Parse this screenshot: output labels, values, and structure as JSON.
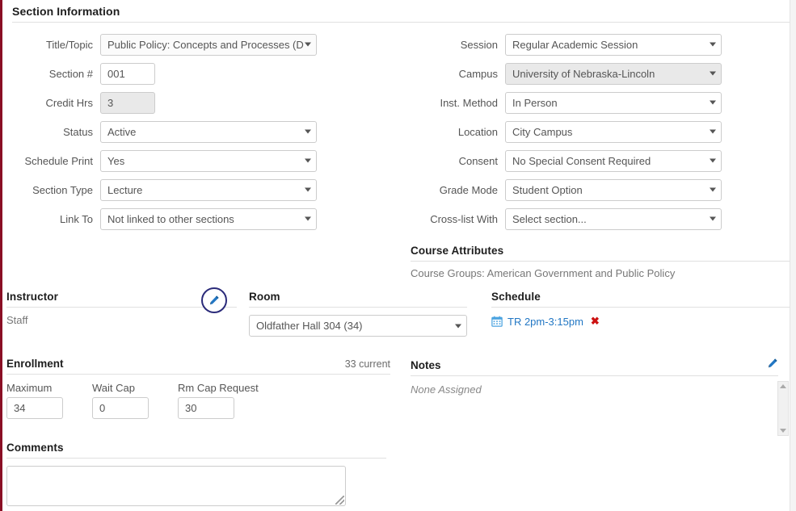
{
  "section_information": {
    "heading": "Section Information",
    "left_fields": [
      {
        "label": "Title/Topic",
        "value": "Public Policy: Concepts and Processes (D",
        "type": "select",
        "state": "readonly-light"
      },
      {
        "label": "Section #",
        "value": "001",
        "type": "input",
        "state": "normal"
      },
      {
        "label": "Credit Hrs",
        "value": "3",
        "type": "input",
        "state": "disabled"
      },
      {
        "label": "Status",
        "value": "Active",
        "type": "select",
        "state": "normal"
      },
      {
        "label": "Schedule Print",
        "value": "Yes",
        "type": "select",
        "state": "normal"
      },
      {
        "label": "Section Type",
        "value": "Lecture",
        "type": "select",
        "state": "normal"
      },
      {
        "label": "Link To",
        "value": "Not linked to other sections",
        "type": "select",
        "state": "normal"
      }
    ],
    "right_fields": [
      {
        "label": "Session",
        "value": "Regular Academic Session",
        "type": "select",
        "state": "normal"
      },
      {
        "label": "Campus",
        "value": "University of Nebraska-Lincoln",
        "type": "select",
        "state": "disabled"
      },
      {
        "label": "Inst. Method",
        "value": "In Person",
        "type": "select",
        "state": "normal"
      },
      {
        "label": "Location",
        "value": "City Campus",
        "type": "select",
        "state": "normal"
      },
      {
        "label": "Consent",
        "value": "No Special Consent Required",
        "type": "select",
        "state": "normal"
      },
      {
        "label": "Grade Mode",
        "value": "Student Option",
        "type": "select",
        "state": "normal"
      },
      {
        "label": "Cross-list With",
        "value": "Select section...",
        "type": "select",
        "state": "normal"
      }
    ]
  },
  "course_attributes": {
    "heading": "Course Attributes",
    "text": "Course Groups: American Government and Public Policy"
  },
  "instructor": {
    "heading": "Instructor",
    "value": "Staff",
    "edit_icon": "pencil-icon"
  },
  "room": {
    "heading": "Room",
    "value": "Oldfather Hall 304 (34)"
  },
  "schedule": {
    "heading": "Schedule",
    "calendar_icon": "calendar-icon",
    "entry": "TR 2pm-3:15pm",
    "delete_icon": "x-delete-icon"
  },
  "enrollment": {
    "heading": "Enrollment",
    "current": "33 current",
    "fields": [
      {
        "label": "Maximum",
        "value": "34"
      },
      {
        "label": "Wait Cap",
        "value": "0"
      },
      {
        "label": "Rm Cap Request",
        "value": "30"
      }
    ]
  },
  "notes": {
    "heading": "Notes",
    "value": "None Assigned",
    "edit_icon": "pencil-icon"
  },
  "comments": {
    "heading": "Comments",
    "value": ""
  },
  "colors": {
    "accent_maroon": "#8a0f25",
    "link_blue": "#2277c4",
    "edit_circle_navy": "#2b2b7a",
    "delete_red": "#cc1111",
    "disabled_gray": "#e9e9e9"
  }
}
